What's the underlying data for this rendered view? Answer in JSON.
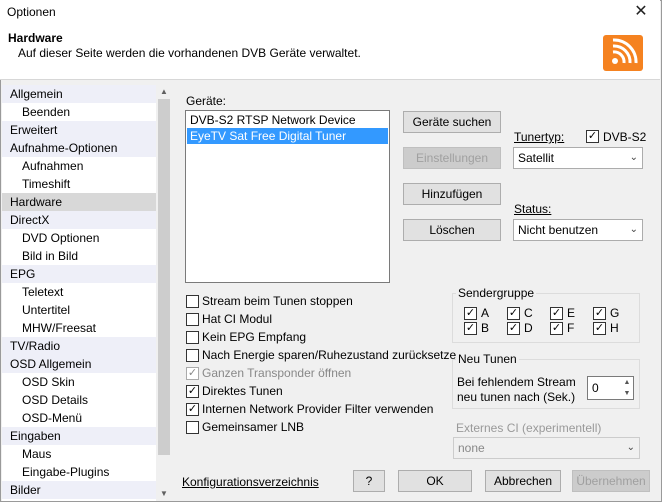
{
  "window": {
    "title": "Optionen",
    "close": "✕"
  },
  "header": {
    "title": "Hardware",
    "subtitle": "Auf dieser Seite werden die vorhandenen DVB Geräte verwaltet."
  },
  "sidebar": [
    {
      "label": "Allgemein",
      "level": 0
    },
    {
      "label": "Beenden",
      "level": 1
    },
    {
      "label": "Erweitert",
      "level": 0
    },
    {
      "label": "Aufnahme-Optionen",
      "level": 0
    },
    {
      "label": "Aufnahmen",
      "level": 1
    },
    {
      "label": "Timeshift",
      "level": 1
    },
    {
      "label": "Hardware",
      "level": 0,
      "selected": true
    },
    {
      "label": "DirectX",
      "level": 0
    },
    {
      "label": "DVD Optionen",
      "level": 1
    },
    {
      "label": "Bild in Bild",
      "level": 1
    },
    {
      "label": "EPG",
      "level": 0
    },
    {
      "label": "Teletext",
      "level": 1
    },
    {
      "label": "Untertitel",
      "level": 1
    },
    {
      "label": "MHW/Freesat",
      "level": 1
    },
    {
      "label": "TV/Radio",
      "level": 0
    },
    {
      "label": "OSD Allgemein",
      "level": 0
    },
    {
      "label": "OSD Skin",
      "level": 1
    },
    {
      "label": "OSD Details",
      "level": 1
    },
    {
      "label": "OSD-Menü",
      "level": 1
    },
    {
      "label": "Eingaben",
      "level": 0
    },
    {
      "label": "Maus",
      "level": 1
    },
    {
      "label": "Eingabe-Plugins",
      "level": 1
    },
    {
      "label": "Bilder",
      "level": 0
    }
  ],
  "devices": {
    "label": "Geräte:",
    "items": [
      "DVB-S2 RTSP Network Device",
      "EyeTV Sat Free Digital Tuner"
    ],
    "selected_index": 1
  },
  "buttons": {
    "search": "Geräte suchen",
    "settings": "Einstellungen",
    "add": "Hinzufügen",
    "delete": "Löschen",
    "help": "?",
    "ok": "OK",
    "cancel": "Abbrechen",
    "apply": "Übernehmen"
  },
  "tunertype": {
    "label": "Tunertyp:",
    "dvbs2_label": "DVB-S2",
    "dvbs2_checked": true,
    "value": "Satellit"
  },
  "status": {
    "label": "Status:",
    "value": "Nicht benutzen"
  },
  "options": [
    {
      "label": "Stream beim Tunen stoppen",
      "checked": false,
      "disabled": false
    },
    {
      "label": "Hat CI Modul",
      "checked": false,
      "disabled": false
    },
    {
      "label": "Kein EPG Empfang",
      "checked": false,
      "disabled": false
    },
    {
      "label": "Nach Energie sparen/Ruhezustand zurücksetze",
      "checked": false,
      "disabled": false
    },
    {
      "label": "Ganzen Transponder öffnen",
      "checked": true,
      "disabled": true
    },
    {
      "label": "Direktes Tunen",
      "checked": true,
      "disabled": false
    },
    {
      "label": "Internen Network Provider Filter verwenden",
      "checked": true,
      "disabled": false
    },
    {
      "label": "Gemeinsamer LNB",
      "checked": false,
      "disabled": false
    }
  ],
  "sendergruppe": {
    "title": "Sendergruppe",
    "items": [
      {
        "label": "A",
        "checked": true
      },
      {
        "label": "C",
        "checked": true
      },
      {
        "label": "E",
        "checked": true
      },
      {
        "label": "G",
        "checked": true
      },
      {
        "label": "B",
        "checked": true
      },
      {
        "label": "D",
        "checked": true
      },
      {
        "label": "F",
        "checked": true
      },
      {
        "label": "H",
        "checked": true
      }
    ]
  },
  "neutunen": {
    "title": "Neu Tunen",
    "label_line1": "Bei fehlendem Stream",
    "label_line2": "neu tunen nach (Sek.)",
    "value": "0"
  },
  "externes_ci": {
    "label": "Externes CI (experimentell)",
    "value": "none"
  },
  "link": "Konfigurationsverzeichnis"
}
